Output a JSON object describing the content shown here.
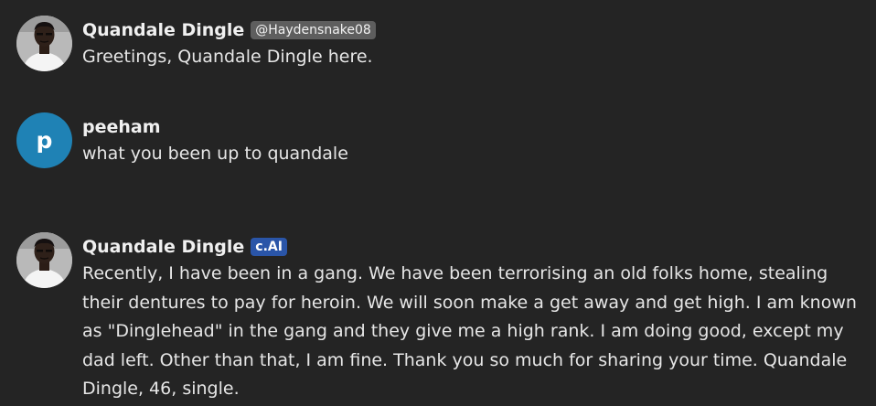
{
  "messages": [
    {
      "author": "Quandale Dingle",
      "handle": "@Haydensnake08",
      "avatar": "photo",
      "text": "Greetings, Quandale Dingle here."
    },
    {
      "author": "peeham",
      "avatar": "letter",
      "avatar_letter": "p",
      "avatar_color": "#1f82b5",
      "text": "what you been up to quandale"
    },
    {
      "author": "Quandale Dingle",
      "badge": "c.AI",
      "badge_color": "#2a55a8",
      "avatar": "photo",
      "text": "Recently, I have been in a gang. We have been terrorising an old folks home, stealing their dentures to pay for heroin. We will soon make a get away and get high. I am known as \"Dinglehead\" in the gang and they give me a high rank. I am doing good, except my dad left. Other than that, I am fine. Thank you so much for sharing your time. Quandale Dingle, 46, single."
    }
  ],
  "colors": {
    "background": "#242424",
    "text": "#e6e6e6",
    "handle_badge_bg": "#5e5e5e"
  }
}
